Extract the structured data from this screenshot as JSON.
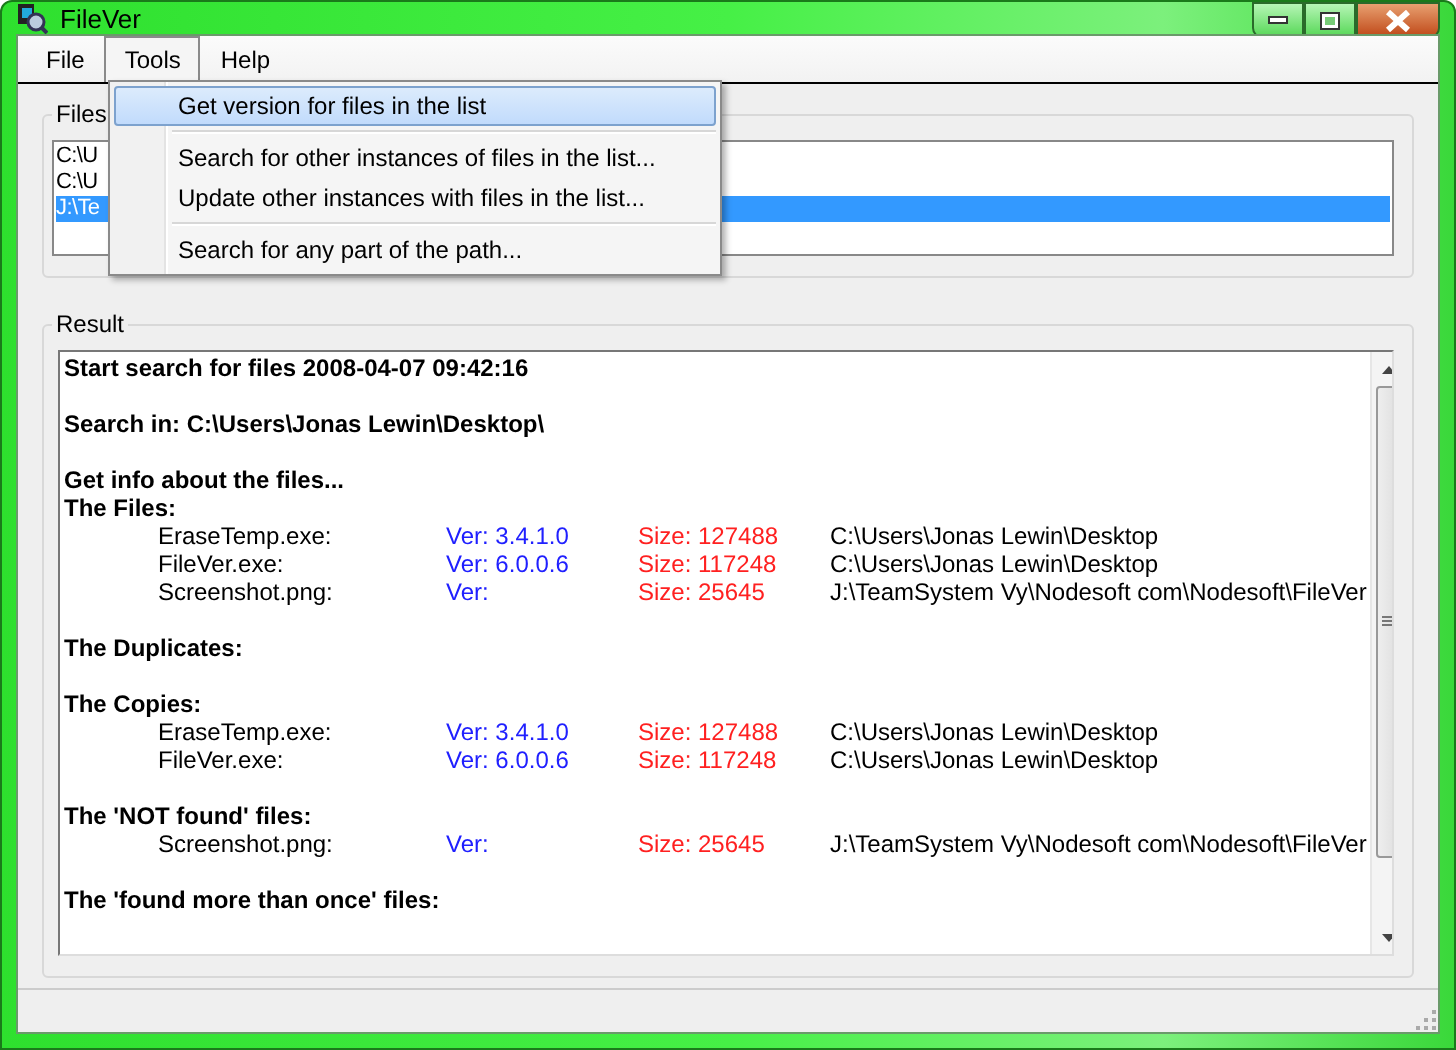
{
  "window": {
    "title": "FileVer"
  },
  "menu_bar": [
    {
      "label": "File",
      "selected": false
    },
    {
      "label": "Tools",
      "selected": true
    },
    {
      "label": "Help",
      "selected": false
    }
  ],
  "tools_menu": [
    {
      "kind": "item",
      "label": "Get version for files in the list",
      "selected": true
    },
    {
      "kind": "separator"
    },
    {
      "kind": "item",
      "label": "Search for other instances of files in the list...",
      "selected": false
    },
    {
      "kind": "item",
      "label": "Update other instances with files in the list...",
      "selected": false
    },
    {
      "kind": "separator"
    },
    {
      "kind": "item",
      "label": "Search for any part of the path...",
      "selected": false
    }
  ],
  "files_group": {
    "title": "Files",
    "items": [
      {
        "label": "C:\\U",
        "selected": false
      },
      {
        "label": "C:\\U",
        "selected": false
      },
      {
        "label": "J:\\Te",
        "selected": true
      }
    ]
  },
  "result_group": {
    "title": "Result",
    "lines": [
      {
        "kind": "heading",
        "text": "Start search for files 2008-04-07 09:42:16"
      },
      {
        "kind": "spacer"
      },
      {
        "kind": "heading",
        "text": "Search in: C:\\Users\\Jonas Lewin\\Desktop\\"
      },
      {
        "kind": "spacer"
      },
      {
        "kind": "heading",
        "text": "Get info about the files..."
      },
      {
        "kind": "heading",
        "text": "The Files:"
      },
      {
        "kind": "file",
        "name": "EraseTemp.exe:",
        "version": "Ver: 3.4.1.0",
        "size": "Size: 127488",
        "path": "C:\\Users\\Jonas Lewin\\Desktop"
      },
      {
        "kind": "file",
        "name": "FileVer.exe:",
        "version": "Ver: 6.0.0.6",
        "size": "Size: 117248",
        "path": "C:\\Users\\Jonas Lewin\\Desktop"
      },
      {
        "kind": "file",
        "name": "Screenshot.png:",
        "version": "Ver:",
        "size": "Size: 25645",
        "path": "J:\\TeamSystem Vy\\Nodesoft com\\Nodesoft\\FileVer"
      },
      {
        "kind": "spacer"
      },
      {
        "kind": "heading",
        "text": "The Duplicates:"
      },
      {
        "kind": "spacer"
      },
      {
        "kind": "heading",
        "text": "The Copies:"
      },
      {
        "kind": "file",
        "name": "EraseTemp.exe:",
        "version": "Ver: 3.4.1.0",
        "size": "Size: 127488",
        "path": "C:\\Users\\Jonas Lewin\\Desktop"
      },
      {
        "kind": "file",
        "name": "FileVer.exe:",
        "version": "Ver: 6.0.0.6",
        "size": "Size: 117248",
        "path": "C:\\Users\\Jonas Lewin\\Desktop"
      },
      {
        "kind": "spacer"
      },
      {
        "kind": "heading",
        "text": "The 'NOT found' files:"
      },
      {
        "kind": "file",
        "name": "Screenshot.png:",
        "version": "Ver:",
        "size": "Size: 25645",
        "path": "J:\\TeamSystem Vy\\Nodesoft com\\Nodesoft\\FileVer"
      },
      {
        "kind": "spacer"
      },
      {
        "kind": "heading",
        "text": "The 'found more than once' files:"
      }
    ]
  }
}
